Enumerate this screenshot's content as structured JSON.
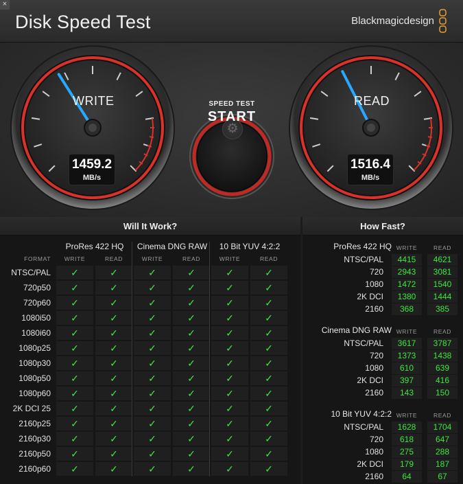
{
  "window": {
    "close_glyph": "×",
    "title": "Disk Speed Test",
    "brand": "Blackmagicdesign"
  },
  "gauges": {
    "write": {
      "label": "WRITE",
      "value": "1459.2",
      "unit": "MB/s",
      "needle_fraction": 0.38
    },
    "read": {
      "label": "READ",
      "value": "1516.4",
      "unit": "MB/s",
      "needle_fraction": 0.4
    }
  },
  "start_button": {
    "line1": "SPEED TEST",
    "line2": "START"
  },
  "settings_icon": "gear-icon",
  "will_it_work": {
    "title": "Will It Work?",
    "format_label": "FORMAT",
    "codecs": [
      "ProRes 422 HQ",
      "Cinema DNG RAW",
      "10 Bit YUV 4:2:2"
    ],
    "sub_labels": [
      "WRITE",
      "READ"
    ],
    "check_glyph": "✓",
    "rows": [
      "NTSC/PAL",
      "720p50",
      "720p60",
      "1080i50",
      "1080i60",
      "1080p25",
      "1080p30",
      "1080p50",
      "1080p60",
      "2K DCI 25",
      "2160p25",
      "2160p30",
      "2160p50",
      "2160p60"
    ]
  },
  "how_fast": {
    "title": "How Fast?",
    "sub_labels": [
      "WRITE",
      "READ"
    ],
    "groups": [
      {
        "name": "ProRes 422 HQ",
        "rows": [
          {
            "format": "NTSC/PAL",
            "write": "4415",
            "read": "4621"
          },
          {
            "format": "720",
            "write": "2943",
            "read": "3081"
          },
          {
            "format": "1080",
            "write": "1472",
            "read": "1540"
          },
          {
            "format": "2K DCI",
            "write": "1380",
            "read": "1444"
          },
          {
            "format": "2160",
            "write": "368",
            "read": "385"
          }
        ]
      },
      {
        "name": "Cinema DNG RAW",
        "rows": [
          {
            "format": "NTSC/PAL",
            "write": "3617",
            "read": "3787"
          },
          {
            "format": "720",
            "write": "1373",
            "read": "1438"
          },
          {
            "format": "1080",
            "write": "610",
            "read": "639"
          },
          {
            "format": "2K DCI",
            "write": "397",
            "read": "416"
          },
          {
            "format": "2160",
            "write": "143",
            "read": "150"
          }
        ]
      },
      {
        "name": "10 Bit YUV 4:2:2",
        "rows": [
          {
            "format": "NTSC/PAL",
            "write": "1628",
            "read": "1704"
          },
          {
            "format": "720",
            "write": "618",
            "read": "647"
          },
          {
            "format": "1080",
            "write": "275",
            "read": "288"
          },
          {
            "format": "2K DCI",
            "write": "179",
            "read": "187"
          },
          {
            "format": "2160",
            "write": "64",
            "read": "67"
          }
        ]
      }
    ]
  },
  "colors": {
    "accent_red": "#d8322a",
    "needle_blue": "#29a8ff",
    "check_green": "#3ee63e"
  }
}
